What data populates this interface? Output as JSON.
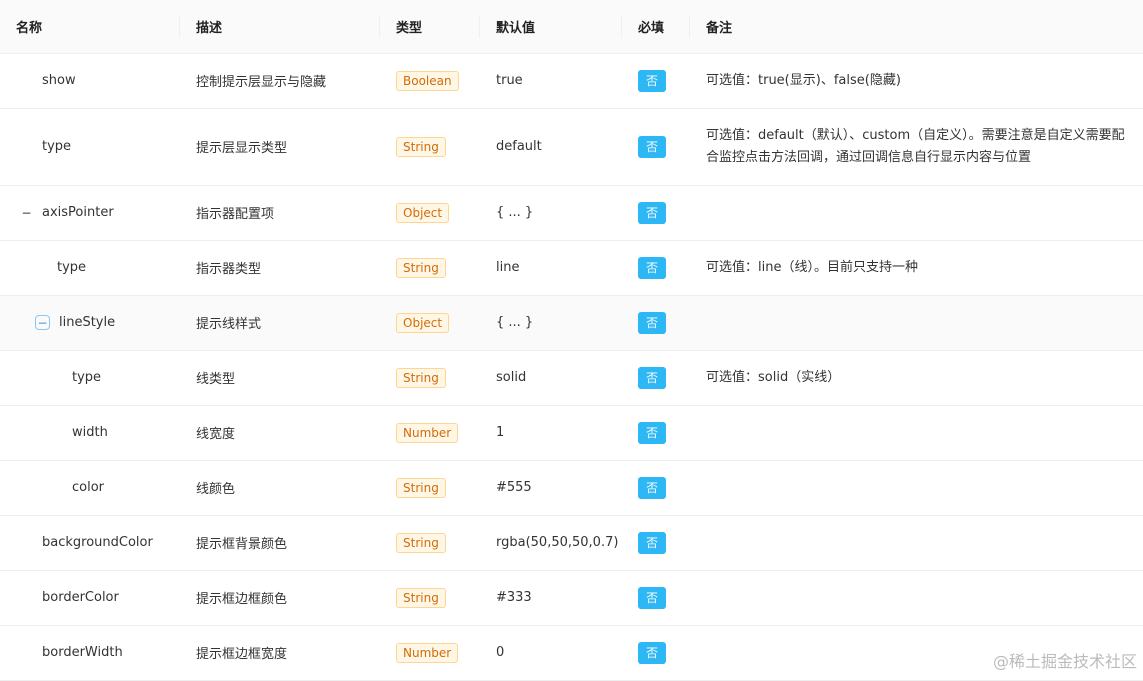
{
  "headers": [
    "名称",
    "描述",
    "类型",
    "默认值",
    "必填",
    "备注"
  ],
  "rows": [
    {
      "name": "show",
      "desc": "控制提示层显示与隐藏",
      "type": "Boolean",
      "default": "true",
      "required": "否",
      "remark": "可选值：true(显示)、false(隐藏)"
    },
    {
      "name": "type",
      "desc": "提示层显示类型",
      "type": "String",
      "default": "default",
      "required": "否",
      "remark": "可选值：default（默认）、custom（自定义）。需要注意是自定义需要配合监控点击方法回调，通过回调信息自行显示内容与位置"
    },
    {
      "name": "axisPointer",
      "desc": "指示器配置项",
      "type": "Object",
      "default": "{ ... }",
      "required": "否",
      "remark": "",
      "toggle": "−"
    },
    {
      "name": "type",
      "desc": "指示器类型",
      "type": "String",
      "default": "line",
      "required": "否",
      "remark": "可选值：line（线）。目前只支持一种"
    },
    {
      "name": "lineStyle",
      "desc": "提示线样式",
      "type": "Object",
      "default": "{ ... }",
      "required": "否",
      "remark": "",
      "toggle": "−"
    },
    {
      "name": "type",
      "desc": "线类型",
      "type": "String",
      "default": "solid",
      "required": "否",
      "remark": "可选值：solid（实线）"
    },
    {
      "name": "width",
      "desc": "线宽度",
      "type": "Number",
      "default": "1",
      "required": "否",
      "remark": ""
    },
    {
      "name": "color",
      "desc": "线颜色",
      "type": "String",
      "default": "#555",
      "required": "否",
      "remark": ""
    },
    {
      "name": "backgroundColor",
      "desc": "提示框背景颜色",
      "type": "String",
      "default": "rgba(50,50,50,0.7)",
      "required": "否",
      "remark": ""
    },
    {
      "name": "borderColor",
      "desc": "提示框边框颜色",
      "type": "String",
      "default": "#333",
      "required": "否",
      "remark": ""
    },
    {
      "name": "borderWidth",
      "desc": "提示框边框宽度",
      "type": "Number",
      "default": "0",
      "required": "否",
      "remark": ""
    }
  ],
  "watermark": "@稀土掘金技术社区"
}
